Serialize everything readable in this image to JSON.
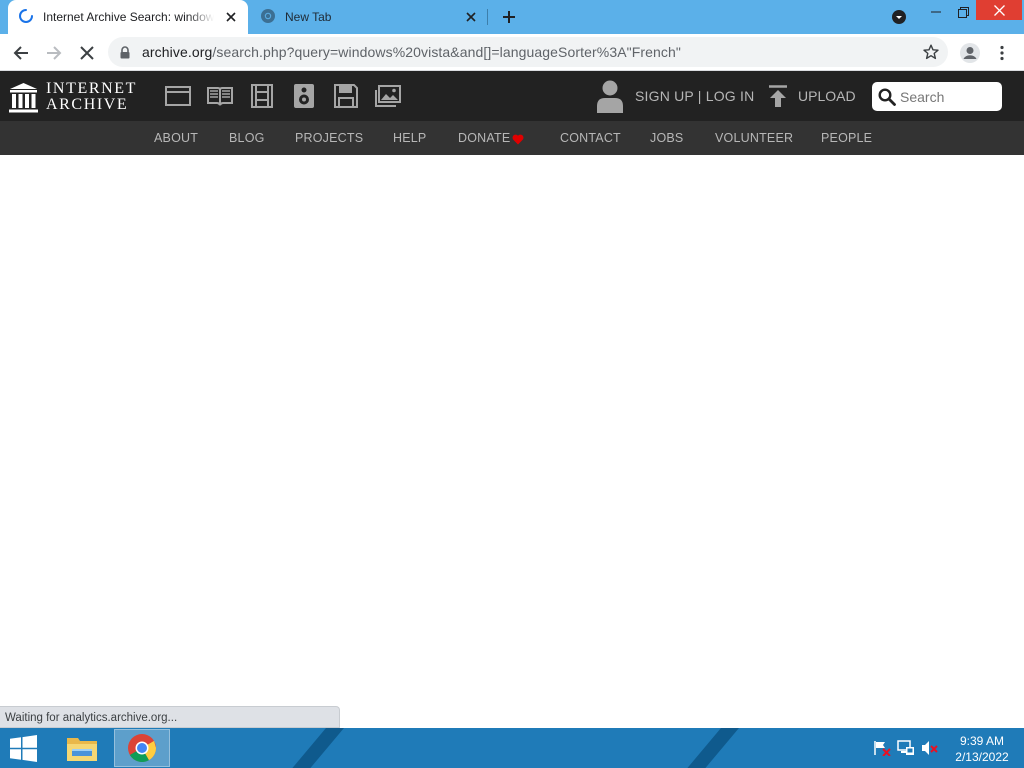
{
  "browser": {
    "tabs": [
      {
        "title": "Internet Archive Search: windows vista",
        "active": true
      },
      {
        "title": "New Tab",
        "active": false
      }
    ],
    "address_bar": {
      "domain": "archive.org",
      "path": "/search.php?query=windows%20vista&and[]=languageSorter%3A\"French\""
    },
    "status_text": "Waiting for analytics.archive.org...",
    "colors": {
      "tabstrip": "#5bb0e9",
      "close_button": "#e03e32"
    }
  },
  "ia_header": {
    "logo_line1": "INTERNET",
    "logo_line2": "ARCHIVE",
    "media_icons": [
      "web-icon",
      "texts-icon",
      "video-icon",
      "audio-icon",
      "software-icon",
      "images-icon"
    ],
    "auth_label": "SIGN UP | LOG IN",
    "upload_label": "UPLOAD",
    "search_placeholder": "Search",
    "nav": [
      {
        "label": "ABOUT"
      },
      {
        "label": "BLOG"
      },
      {
        "label": "PROJECTS"
      },
      {
        "label": "HELP"
      },
      {
        "label": "DONATE",
        "icon": "heart-icon"
      },
      {
        "label": "CONTACT"
      },
      {
        "label": "JOBS"
      },
      {
        "label": "VOLUNTEER"
      },
      {
        "label": "PEOPLE"
      }
    ],
    "colors": {
      "top_bar": "#222222",
      "nav_bar": "#333333",
      "heart": "#e00000"
    }
  },
  "taskbar": {
    "apps": [
      "file-explorer-icon",
      "chrome-icon"
    ],
    "active_app": "chrome-icon",
    "tray_icons": [
      "action-center-flag-icon",
      "network-icon",
      "volume-muted-icon"
    ],
    "time": "9:39 AM",
    "date": "2/13/2022",
    "color": "#1f7bb8"
  }
}
